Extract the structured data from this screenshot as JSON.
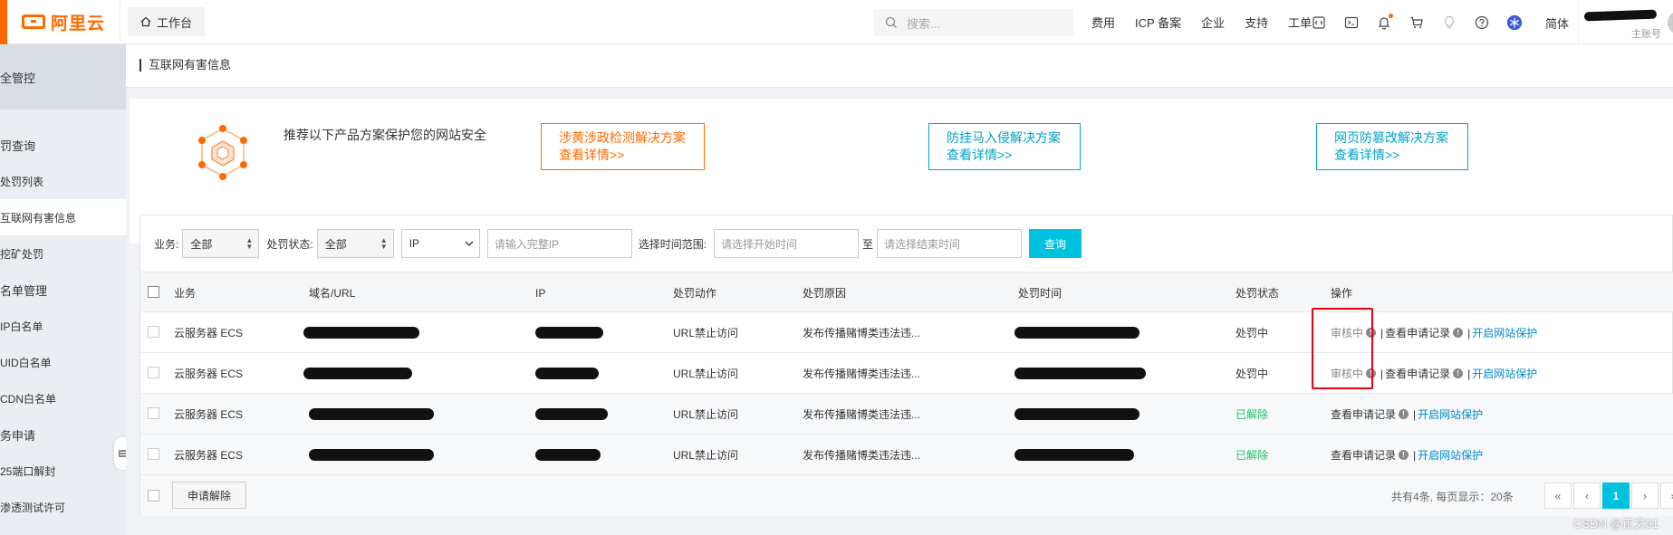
{
  "topbar": {
    "logo_text": "阿里云",
    "workbench": "工作台",
    "search_placeholder": "搜索...",
    "nav": [
      "费用",
      "ICP 备案",
      "企业",
      "支持",
      "工单"
    ],
    "lang": "简体",
    "account_sub": "主账号",
    "notify_dot_color": "#ff6a00"
  },
  "sidebar": {
    "header": "全管控",
    "items": [
      {
        "label": "罚查询",
        "group": true
      },
      {
        "label": "处罚列表",
        "group": false
      },
      {
        "label": "互联网有害信息",
        "group": false,
        "active": true
      },
      {
        "label": "挖矿处罚",
        "group": false
      },
      {
        "label": "名单管理",
        "group": true
      },
      {
        "label": "IP白名单",
        "group": false
      },
      {
        "label": "UID白名单",
        "group": false
      },
      {
        "label": "CDN白名单",
        "group": false
      },
      {
        "label": "务申请",
        "group": true
      },
      {
        "label": "25端口解封",
        "group": false
      },
      {
        "label": "渗透测试许可",
        "group": false
      }
    ]
  },
  "page": {
    "title": "互联网有害信息"
  },
  "promo": {
    "text": "推荐以下产品方案保护您的网站安全",
    "boxes": [
      {
        "title": "涉黄涉政检测解决方案",
        "link": "查看详情>>"
      },
      {
        "title": "防挂马入侵解决方案",
        "link": "查看详情>>"
      },
      {
        "title": "网页防篡改解决方案",
        "link": "查看详情>>"
      }
    ]
  },
  "filters": {
    "business_label": "业务:",
    "business_value": "全部",
    "status_label": "处罚状态:",
    "status_value": "全部",
    "ip_type": "IP",
    "ip_placeholder": "请输入完整IP",
    "time_label": "选择时间范围:",
    "start_placeholder": "请选择开始时间",
    "to": "至",
    "end_placeholder": "请选择结束时间",
    "query": "查询"
  },
  "table": {
    "headers": [
      "业务",
      "域名/URL",
      "IP",
      "处罚动作",
      "处罚原因",
      "处罚时间",
      "处罚状态",
      "操作"
    ],
    "rows": [
      {
        "business": "云服务器 ECS",
        "action": "URL禁止访问",
        "reason": "发布传播赌博类违法违...",
        "status": "处罚中",
        "status_type": "active",
        "op_review": "审核中",
        "op_record": "查看申请记录",
        "op_protect": "开启网站保护"
      },
      {
        "business": "云服务器 ECS",
        "action": "URL禁止访问",
        "reason": "发布传播赌博类违法违...",
        "status": "处罚中",
        "status_type": "active",
        "op_review": "审核中",
        "op_record": "查看申请记录",
        "op_protect": "开启网站保护"
      },
      {
        "business": "云服务器 ECS",
        "action": "URL禁止访问",
        "reason": "发布传播赌博类违法违...",
        "status": "已解除",
        "status_type": "released",
        "op_review": "",
        "op_record": "查看申请记录",
        "op_protect": "开启网站保护"
      },
      {
        "business": "云服务器 ECS",
        "action": "URL禁止访问",
        "reason": "发布传播赌博类违法违...",
        "status": "已解除",
        "status_type": "released",
        "op_review": "",
        "op_record": "查看申请记录",
        "op_protect": "开启网站保护"
      }
    ]
  },
  "footer": {
    "apply": "申请解除",
    "page_info": "共有4条, 每页显示：20条",
    "pager": [
      "«",
      "‹",
      "1",
      "›",
      "»"
    ],
    "current_page": "1"
  },
  "watermark": "CSDN @正文01",
  "colors": {
    "brand": "#ff6a00",
    "primary_button": "#00c1de",
    "promo_blue": "#00a2ca",
    "released_green": "#1ebf6a",
    "highlight_red": "#e60012"
  }
}
